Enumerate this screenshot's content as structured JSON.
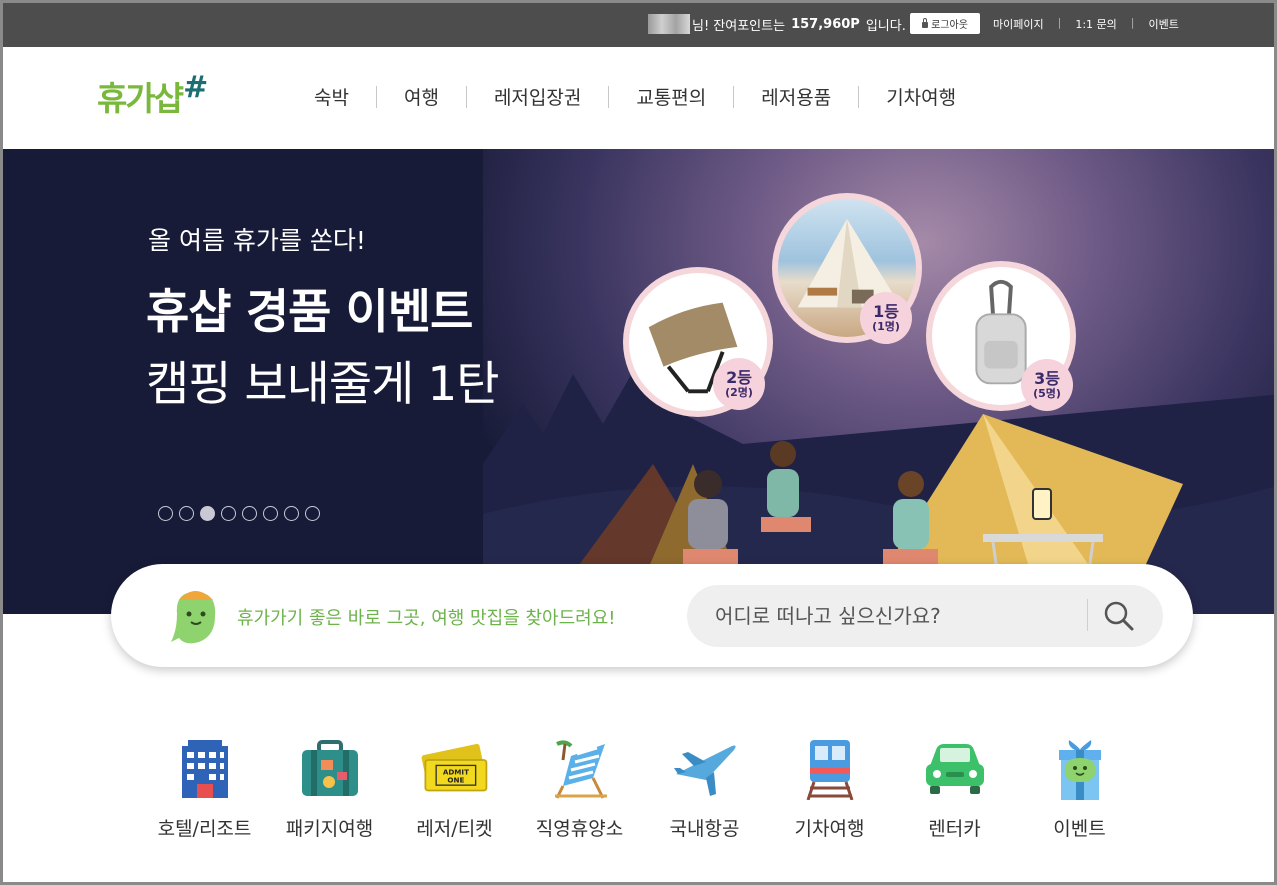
{
  "topbar": {
    "greeting_suffix": "님! 잔여포인트는",
    "points": "157,960P",
    "greeting_end": "입니다.",
    "logout_label": "로그아웃",
    "links": [
      "마이페이지",
      "1:1 문의",
      "이벤트"
    ]
  },
  "header": {
    "logo_text": "휴가샵",
    "logo_mark": "#",
    "nav": [
      "숙박",
      "여행",
      "레저입장권",
      "교통편의",
      "레저용품",
      "기차여행"
    ]
  },
  "hero": {
    "subtitle": "올 여름 휴가를 쏜다!",
    "title": "휴샵 경품 이벤트",
    "title2": "캠핑 보내줄게 1탄",
    "slide_count": 8,
    "active_slide": 3,
    "prizes": [
      {
        "rank": "1등",
        "count": "(1명)"
      },
      {
        "rank": "2등",
        "count": "(2명)"
      },
      {
        "rank": "3등",
        "count": "(5명)"
      }
    ]
  },
  "search": {
    "message": "휴가가기 좋은 바로 그곳, 여행 맛집을 찾아드려요!",
    "placeholder": "어디로 떠나고 싶으신가요?"
  },
  "categories": [
    {
      "label": "호텔/리조트",
      "icon": "hotel-icon"
    },
    {
      "label": "패키지여행",
      "icon": "suitcase-icon"
    },
    {
      "label": "레저/티켓",
      "icon": "ticket-icon"
    },
    {
      "label": "직영휴양소",
      "icon": "beach-chair-icon"
    },
    {
      "label": "국내항공",
      "icon": "airplane-icon"
    },
    {
      "label": "기차여행",
      "icon": "train-icon"
    },
    {
      "label": "렌터카",
      "icon": "car-icon"
    },
    {
      "label": "이벤트",
      "icon": "gift-icon"
    }
  ],
  "colors": {
    "topbar": "#4d4d4d",
    "hero_bg": "#181b38",
    "brand_green": "#79b83b",
    "brand_teal": "#1c6e73",
    "badge_pink": "#f6d3dc"
  }
}
